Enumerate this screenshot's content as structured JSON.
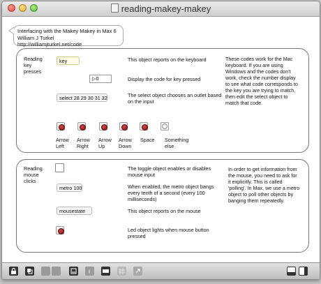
{
  "window": {
    "title": "reading-makey-makey"
  },
  "header_comment": {
    "line1": "Interfacing with the Makey Makey in Max 6",
    "line2": "William J Turkel",
    "line3": "http://williamjturkel.net/code"
  },
  "keys_section": {
    "label": "Reading key presses",
    "key_object": "key",
    "number_box": "0",
    "select_object": "select 28 29 30 31 32",
    "desc_key": "This object reports on the keyboard",
    "desc_number": "Display the code for key pressed",
    "desc_select": "The select object chooses an outlet based on the input",
    "side_note": "These codes work for the Mac keyboard. If you are using Windows and the codes don't work, check the number display to see what code corresponds to the key you are trying to match, then edit the select object to match that code.",
    "outputs": [
      {
        "label": "Arrow Left"
      },
      {
        "label": "Arrow Right"
      },
      {
        "label": "Arrow Up"
      },
      {
        "label": "Arrow Down"
      },
      {
        "label": "Space"
      },
      {
        "label": "Something else"
      }
    ]
  },
  "mouse_section": {
    "label": "Reading mouse clicks",
    "metro_object": "metro 100",
    "mousestate_object": "mousestate",
    "desc_toggle": "The toggle object enables or disables mouse input",
    "desc_metro": "When enabled, the metro object bangs every tenth of a second (every 100 milliseconds)",
    "desc_mousestate": "This object reports on the mouse",
    "desc_led": "Led object lights when mouse button pressed",
    "side_note": "In order to get information from the mouse, you need to ask for it explicitly. This is called 'polling'. In Max, we use a metro object to poll other objects by banging them repeatedly."
  },
  "toolbar": {
    "icons": [
      "lock-icon",
      "copy-icon",
      "presentation-icon",
      "grid-icon",
      "inspector-icon",
      "info-icon",
      "patch-cords-icon",
      "grid-snap-icon",
      "zoom-icon",
      "split-left-icon",
      "split-right-icon"
    ]
  }
}
